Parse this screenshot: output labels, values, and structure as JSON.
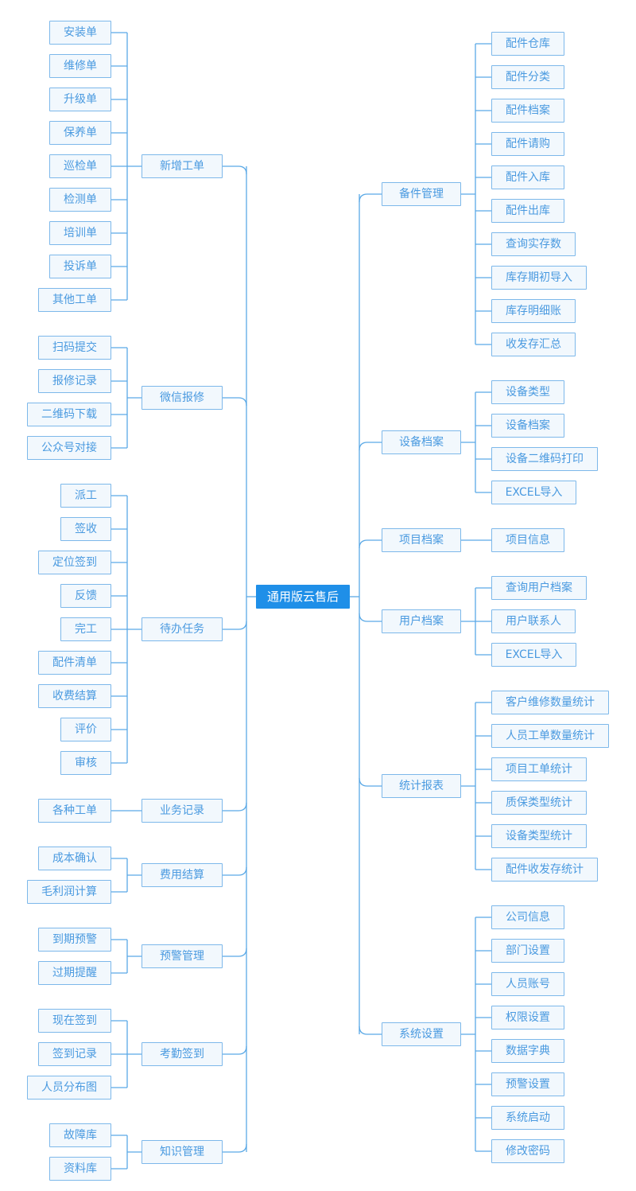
{
  "diagram": {
    "type": "mindmap",
    "root": {
      "label": "通用版云售后",
      "color": "#1f8fe8",
      "text_color": "#ffffff"
    },
    "style": {
      "node_fill": "#f2f8fd",
      "node_border": "#7db8ea",
      "node_text": "#4a9ae0",
      "link_color": "#5ba9e6"
    },
    "left_branches": [
      {
        "label": "新增工单",
        "children": [
          "安装单",
          "维修单",
          "升级单",
          "保养单",
          "巡检单",
          "检测单",
          "培训单",
          "投诉单",
          "其他工单"
        ]
      },
      {
        "label": "微信报修",
        "children": [
          "扫码提交",
          "报修记录",
          "二维码下载",
          "公众号对接"
        ]
      },
      {
        "label": "待办任务",
        "children": [
          "派工",
          "签收",
          "定位签到",
          "反馈",
          "完工",
          "配件清单",
          "收费结算",
          "评价",
          "审核"
        ]
      },
      {
        "label": "业务记录",
        "children": [
          "各种工单"
        ]
      },
      {
        "label": "费用结算",
        "children": [
          "成本确认",
          "毛利润计算"
        ]
      },
      {
        "label": "预警管理",
        "children": [
          "到期预警",
          "过期提醒"
        ]
      },
      {
        "label": "考勤签到",
        "children": [
          "现在签到",
          "签到记录",
          "人员分布图"
        ]
      },
      {
        "label": "知识管理",
        "children": [
          "故障库",
          "资料库"
        ]
      }
    ],
    "right_branches": [
      {
        "label": "备件管理",
        "children": [
          "配件仓库",
          "配件分类",
          "配件档案",
          "配件请购",
          "配件入库",
          "配件出库",
          "查询实存数",
          "库存期初导入",
          "库存明细账",
          "收发存汇总"
        ]
      },
      {
        "label": "设备档案",
        "children": [
          "设备类型",
          "设备档案",
          "设备二维码打印",
          "EXCEL导入"
        ]
      },
      {
        "label": "项目档案",
        "children": [
          "项目信息"
        ]
      },
      {
        "label": "用户档案",
        "children": [
          "查询用户档案",
          "用户联系人",
          "EXCEL导入"
        ]
      },
      {
        "label": "统计报表",
        "children": [
          "客户维修数量统计",
          "人员工单数量统计",
          "项目工单统计",
          "质保类型统计",
          "设备类型统计",
          "配件收发存统计"
        ]
      },
      {
        "label": "系统设置",
        "children": [
          "公司信息",
          "部门设置",
          "人员账号",
          "权限设置",
          "数据字典",
          "预警设置",
          "系统启动",
          "修改密码"
        ]
      }
    ]
  }
}
